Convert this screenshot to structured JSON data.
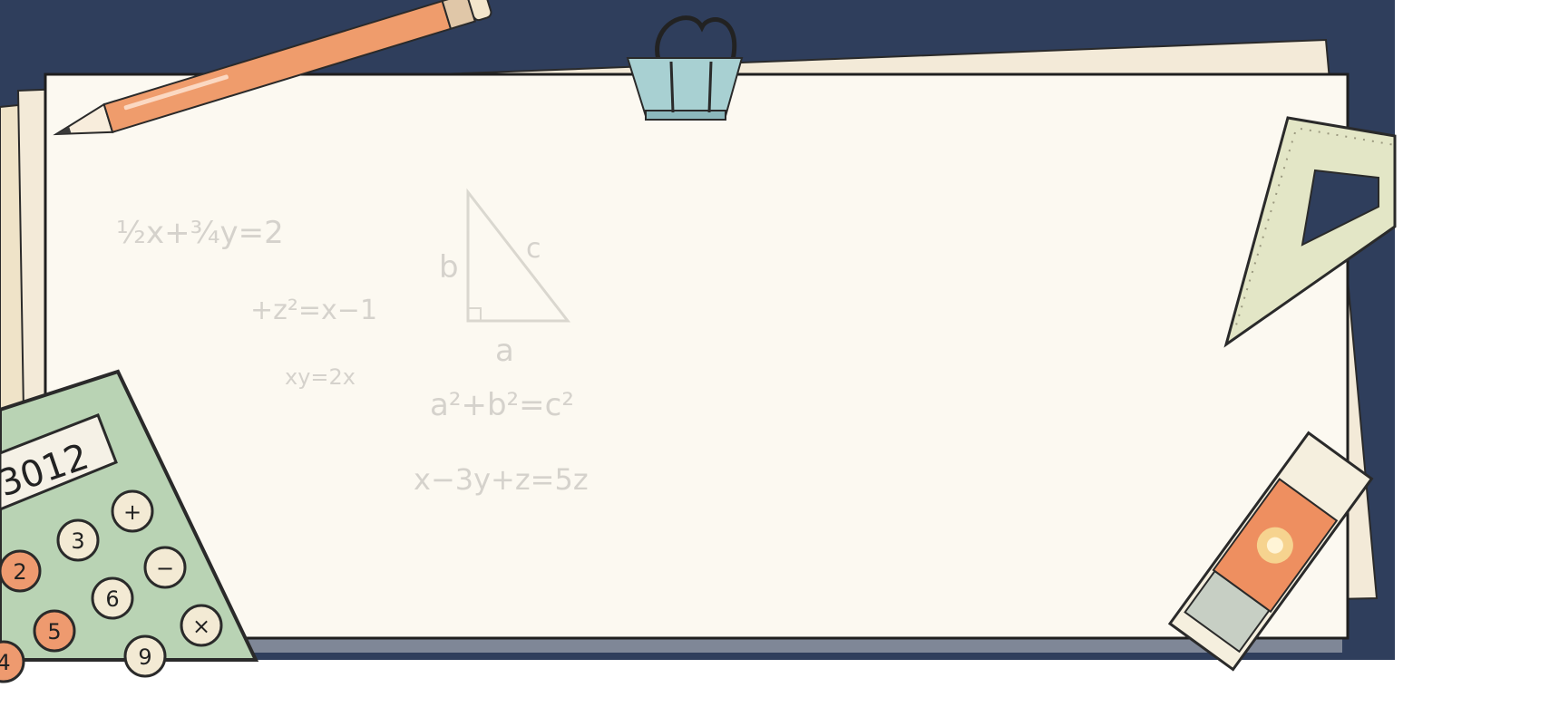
{
  "colors": {
    "board": "#2f3e5c",
    "paper": "#fcf9f1",
    "paper_back": "#efe3c8",
    "pencil": "#ef9c6c",
    "clip": "#a8d0d2",
    "calculator": "#b9d3b4",
    "ruler": "#e3e6c6",
    "eraser": "#ee8f60"
  },
  "icons": [
    "pencil-icon",
    "binder-clip-icon",
    "set-square-icon",
    "eraser-icon",
    "calculator-icon"
  ],
  "calculator": {
    "display": "3012",
    "keys": [
      {
        "label": "+"
      },
      {
        "label": "3"
      },
      {
        "label": "−"
      },
      {
        "label": "2"
      },
      {
        "label": "6"
      },
      {
        "label": "×"
      },
      {
        "label": "5"
      },
      {
        "label": "9"
      },
      {
        "label": "4"
      }
    ]
  },
  "sketches": {
    "eq1": "½x+¾y=2",
    "eq2": "+z²=x−1",
    "eq3": "xy=2x",
    "tri_b": "b",
    "tri_c": "c",
    "tri_a": "a",
    "eq4": "a²+b²=c²",
    "eq5": "x−3y+z=5z"
  }
}
